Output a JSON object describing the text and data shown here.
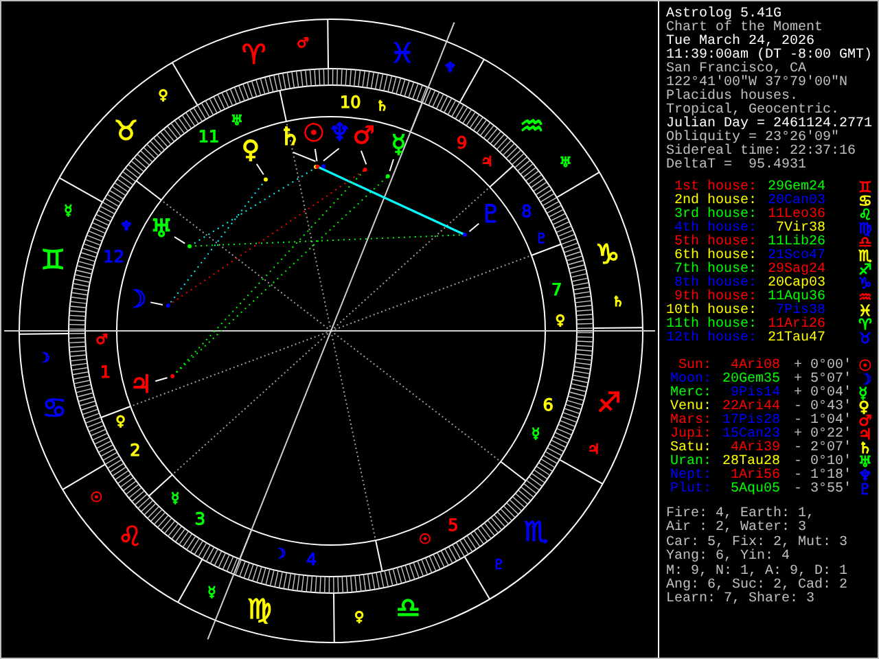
{
  "info_lines": [
    {
      "text": "Astrolog 5.41G",
      "emphasis": true
    },
    {
      "text": "Chart of the Moment",
      "emphasis": false
    },
    {
      "text": "Tue March 24, 2026",
      "emphasis": true
    },
    {
      "text": "11:39:00am (DT -8:00 GMT)",
      "emphasis": true
    },
    {
      "text": "San Francisco, CA",
      "emphasis": false
    },
    {
      "text": "122°41'00\"W 37°79'00\"N",
      "emphasis": false
    },
    {
      "text": "Placidus houses.",
      "emphasis": false
    },
    {
      "text": "Tropical, Geocentric.",
      "emphasis": false
    },
    {
      "text": "Julian Day = 2461124.2771",
      "emphasis": true
    },
    {
      "text": "Obliquity = 23°26'09\"",
      "emphasis": false
    },
    {
      "text": "Sidereal time: 22:37:16",
      "emphasis": false
    },
    {
      "text": "DeltaT =  95.4931",
      "emphasis": false
    }
  ],
  "houses": [
    {
      "label": {
        "text": "1st house:",
        "color": "#ff0000"
      },
      "cusp": {
        "text": "29Gem24",
        "color": "#00ff00"
      },
      "sign": {
        "glyph": "♊",
        "color": "#ff0000"
      }
    },
    {
      "label": {
        "text": "2nd house:",
        "color": "#ffff00"
      },
      "cusp": {
        "text": "20Can03",
        "color": "#0000ff"
      },
      "sign": {
        "glyph": "♋",
        "color": "#ffff00"
      }
    },
    {
      "label": {
        "text": "3rd house:",
        "color": "#00ff00"
      },
      "cusp": {
        "text": "11Leo36",
        "color": "#ff0000"
      },
      "sign": {
        "glyph": "♌",
        "color": "#00ff00"
      }
    },
    {
      "label": {
        "text": "4th house:",
        "color": "#0000ff"
      },
      "cusp": {
        "text": "7Vir38",
        "color": "#ffff00"
      },
      "sign": {
        "glyph": "♍",
        "color": "#0000ff"
      }
    },
    {
      "label": {
        "text": "5th house:",
        "color": "#ff0000"
      },
      "cusp": {
        "text": "11Lib26",
        "color": "#00ff00"
      },
      "sign": {
        "glyph": "♎",
        "color": "#ff0000"
      }
    },
    {
      "label": {
        "text": "6th house:",
        "color": "#ffff00"
      },
      "cusp": {
        "text": "21Sco47",
        "color": "#0000ff"
      },
      "sign": {
        "glyph": "♏",
        "color": "#ffff00"
      }
    },
    {
      "label": {
        "text": "7th house:",
        "color": "#00ff00"
      },
      "cusp": {
        "text": "29Sag24",
        "color": "#ff0000"
      },
      "sign": {
        "glyph": "♐",
        "color": "#00ff00"
      }
    },
    {
      "label": {
        "text": "8th house:",
        "color": "#0000ff"
      },
      "cusp": {
        "text": "20Cap03",
        "color": "#ffff00"
      },
      "sign": {
        "glyph": "♑",
        "color": "#0000ff"
      }
    },
    {
      "label": {
        "text": "9th house:",
        "color": "#ff0000"
      },
      "cusp": {
        "text": "11Aqu36",
        "color": "#00ff00"
      },
      "sign": {
        "glyph": "♒",
        "color": "#ff0000"
      }
    },
    {
      "label": {
        "text": "10th house:",
        "color": "#ffff00"
      },
      "cusp": {
        "text": "7Pis38",
        "color": "#0000ff"
      },
      "sign": {
        "glyph": "♓",
        "color": "#ffff00"
      }
    },
    {
      "label": {
        "text": "11th house:",
        "color": "#00ff00"
      },
      "cusp": {
        "text": "11Ari26",
        "color": "#ff0000"
      },
      "sign": {
        "glyph": "♈",
        "color": "#00ff00"
      }
    },
    {
      "label": {
        "text": "12th house:",
        "color": "#0000ff"
      },
      "cusp": {
        "text": "21Tau47",
        "color": "#ffff00"
      },
      "sign": {
        "glyph": "♉",
        "color": "#0000ff"
      }
    }
  ],
  "planets": [
    {
      "name": {
        "text": "Sun:",
        "color": "#ff0000"
      },
      "position": {
        "text": "4Ari08",
        "color": "#ff0000"
      },
      "speed": "+ 0°00'",
      "glyph": {
        "text": "☉",
        "color": "#ff0000"
      }
    },
    {
      "name": {
        "text": "Moon:",
        "color": "#0000ff"
      },
      "position": {
        "text": "20Gem35",
        "color": "#00ff00"
      },
      "speed": "+ 5°07'",
      "glyph": {
        "text": "☽",
        "color": "#0000ff"
      }
    },
    {
      "name": {
        "text": "Merc:",
        "color": "#00ff00"
      },
      "position": {
        "text": "9Pis14",
        "color": "#0000ff"
      },
      "speed": "+ 0°04'",
      "glyph": {
        "text": "☿",
        "color": "#00ff00"
      }
    },
    {
      "name": {
        "text": "Venu:",
        "color": "#ffff00"
      },
      "position": {
        "text": "22Ari44",
        "color": "#ff0000"
      },
      "speed": "- 0°43'",
      "glyph": {
        "text": "♀",
        "color": "#ffff00"
      }
    },
    {
      "name": {
        "text": "Mars:",
        "color": "#ff0000"
      },
      "position": {
        "text": "17Pis28",
        "color": "#0000ff"
      },
      "speed": "- 1°04'",
      "glyph": {
        "text": "♂",
        "color": "#ff0000"
      }
    },
    {
      "name": {
        "text": "Jupi:",
        "color": "#ff0000"
      },
      "position": {
        "text": "15Can23",
        "color": "#0000ff"
      },
      "speed": "+ 0°22'",
      "glyph": {
        "text": "♃",
        "color": "#ff0000"
      }
    },
    {
      "name": {
        "text": "Satu:",
        "color": "#ffff00"
      },
      "position": {
        "text": "4Ari39",
        "color": "#ff0000"
      },
      "speed": "- 2°07'",
      "glyph": {
        "text": "♄",
        "color": "#ffff00"
      }
    },
    {
      "name": {
        "text": "Uran:",
        "color": "#00ff00"
      },
      "position": {
        "text": "28Tau28",
        "color": "#ffff00"
      },
      "speed": "- 0°10'",
      "glyph": {
        "text": "♅",
        "color": "#00ff00"
      }
    },
    {
      "name": {
        "text": "Nept:",
        "color": "#0000ff"
      },
      "position": {
        "text": "1Ari56",
        "color": "#ff0000"
      },
      "speed": "- 1°18'",
      "glyph": {
        "text": "♆",
        "color": "#0000ff"
      }
    },
    {
      "name": {
        "text": "Plut:",
        "color": "#0000ff"
      },
      "position": {
        "text": "5Aqu05",
        "color": "#00ff00"
      },
      "speed": "- 3°55'",
      "glyph": {
        "text": "♇",
        "color": "#0000ff"
      }
    }
  ],
  "summary": [
    "Fire: 4, Earth: 1,",
    "Air : 2, Water: 3",
    "Car: 5, Fix: 2, Mut: 3",
    "Yang: 6, Yin: 4",
    "M: 9, N: 1, A: 9, D: 1",
    "Ang: 6, Suc: 2, Cad: 2",
    "Learn: 7, Share: 3"
  ],
  "wheel": {
    "signs": [
      {
        "glyph": "♈",
        "color": "#ff0000",
        "ruler": {
          "glyph": "♂",
          "color": "#ff0000"
        }
      },
      {
        "glyph": "♓",
        "color": "#0000ff",
        "ruler": {
          "glyph": "♆",
          "color": "#0000ff"
        }
      },
      {
        "glyph": "♉",
        "color": "#ffff00",
        "ruler": {
          "glyph": "♀",
          "color": "#ffff00"
        }
      },
      {
        "glyph": "♒",
        "color": "#00ff00",
        "ruler": {
          "glyph": "♅",
          "color": "#00ff00"
        }
      },
      {
        "glyph": "♊",
        "color": "#00ff00",
        "ruler": {
          "glyph": "☿",
          "color": "#00ff00"
        }
      },
      {
        "glyph": "♑",
        "color": "#ffff00",
        "ruler": {
          "glyph": "♄",
          "color": "#ffff00"
        }
      },
      {
        "glyph": "♋",
        "color": "#0000ff",
        "ruler": {
          "glyph": "☽",
          "color": "#0000ff"
        }
      },
      {
        "glyph": "♐",
        "color": "#ff0000",
        "ruler": {
          "glyph": "♃",
          "color": "#ff0000"
        }
      },
      {
        "glyph": "♌",
        "color": "#ff0000",
        "ruler": {
          "glyph": "☉",
          "color": "#ff0000"
        }
      },
      {
        "glyph": "♏",
        "color": "#0000ff",
        "ruler": {
          "glyph": "♇",
          "color": "#0000ff"
        }
      },
      {
        "glyph": "♍",
        "color": "#ffff00",
        "ruler": {
          "glyph": "☿",
          "color": "#00ff00"
        }
      },
      {
        "glyph": "♎",
        "color": "#00ff00",
        "ruler": {
          "glyph": "♀",
          "color": "#ffff00"
        }
      }
    ],
    "houses": [
      {
        "number": "1",
        "color": "#ff0000",
        "ruler": {
          "glyph": "♂",
          "color": "#ff0000"
        }
      },
      {
        "number": "2",
        "color": "#ffff00",
        "ruler": {
          "glyph": "♀",
          "color": "#ffff00"
        }
      },
      {
        "number": "3",
        "color": "#00ff00",
        "ruler": {
          "glyph": "☿",
          "color": "#00ff00"
        }
      },
      {
        "number": "4",
        "color": "#0000ff",
        "ruler": {
          "glyph": "☽",
          "color": "#0000ff"
        }
      },
      {
        "number": "5",
        "color": "#ff0000",
        "ruler": {
          "glyph": "☉",
          "color": "#ff0000"
        }
      },
      {
        "number": "6",
        "color": "#ffff00",
        "ruler": {
          "glyph": "☿",
          "color": "#00ff00"
        }
      },
      {
        "number": "7",
        "color": "#00ff00",
        "ruler": {
          "glyph": "♀",
          "color": "#ffff00"
        }
      },
      {
        "number": "8",
        "color": "#0000ff",
        "ruler": {
          "glyph": "♇",
          "color": "#0000ff"
        }
      },
      {
        "number": "9",
        "color": "#ff0000",
        "ruler": {
          "glyph": "♃",
          "color": "#ff0000"
        }
      },
      {
        "number": "10",
        "color": "#ffff00",
        "ruler": {
          "glyph": "♄",
          "color": "#ffff00"
        }
      },
      {
        "number": "11",
        "color": "#00ff00",
        "ruler": {
          "glyph": "♅",
          "color": "#00ff00"
        }
      },
      {
        "number": "12",
        "color": "#0000ff",
        "ruler": {
          "glyph": "♆",
          "color": "#0000ff"
        }
      }
    ],
    "planets": [
      {
        "glyph": "♀",
        "color": "#ffff00"
      },
      {
        "glyph": "♄",
        "color": "#ffff00"
      },
      {
        "glyph": "☉",
        "color": "#ff0000"
      },
      {
        "glyph": "♆",
        "color": "#0000ff"
      },
      {
        "glyph": "♂",
        "color": "#ff0000"
      },
      {
        "glyph": "☿",
        "color": "#00ff00"
      },
      {
        "glyph": "♇",
        "color": "#0000ff"
      },
      {
        "glyph": "♅",
        "color": "#00ff00"
      },
      {
        "glyph": "☽",
        "color": "#0000ff"
      },
      {
        "glyph": "♃",
        "color": "#ff0000"
      }
    ]
  }
}
